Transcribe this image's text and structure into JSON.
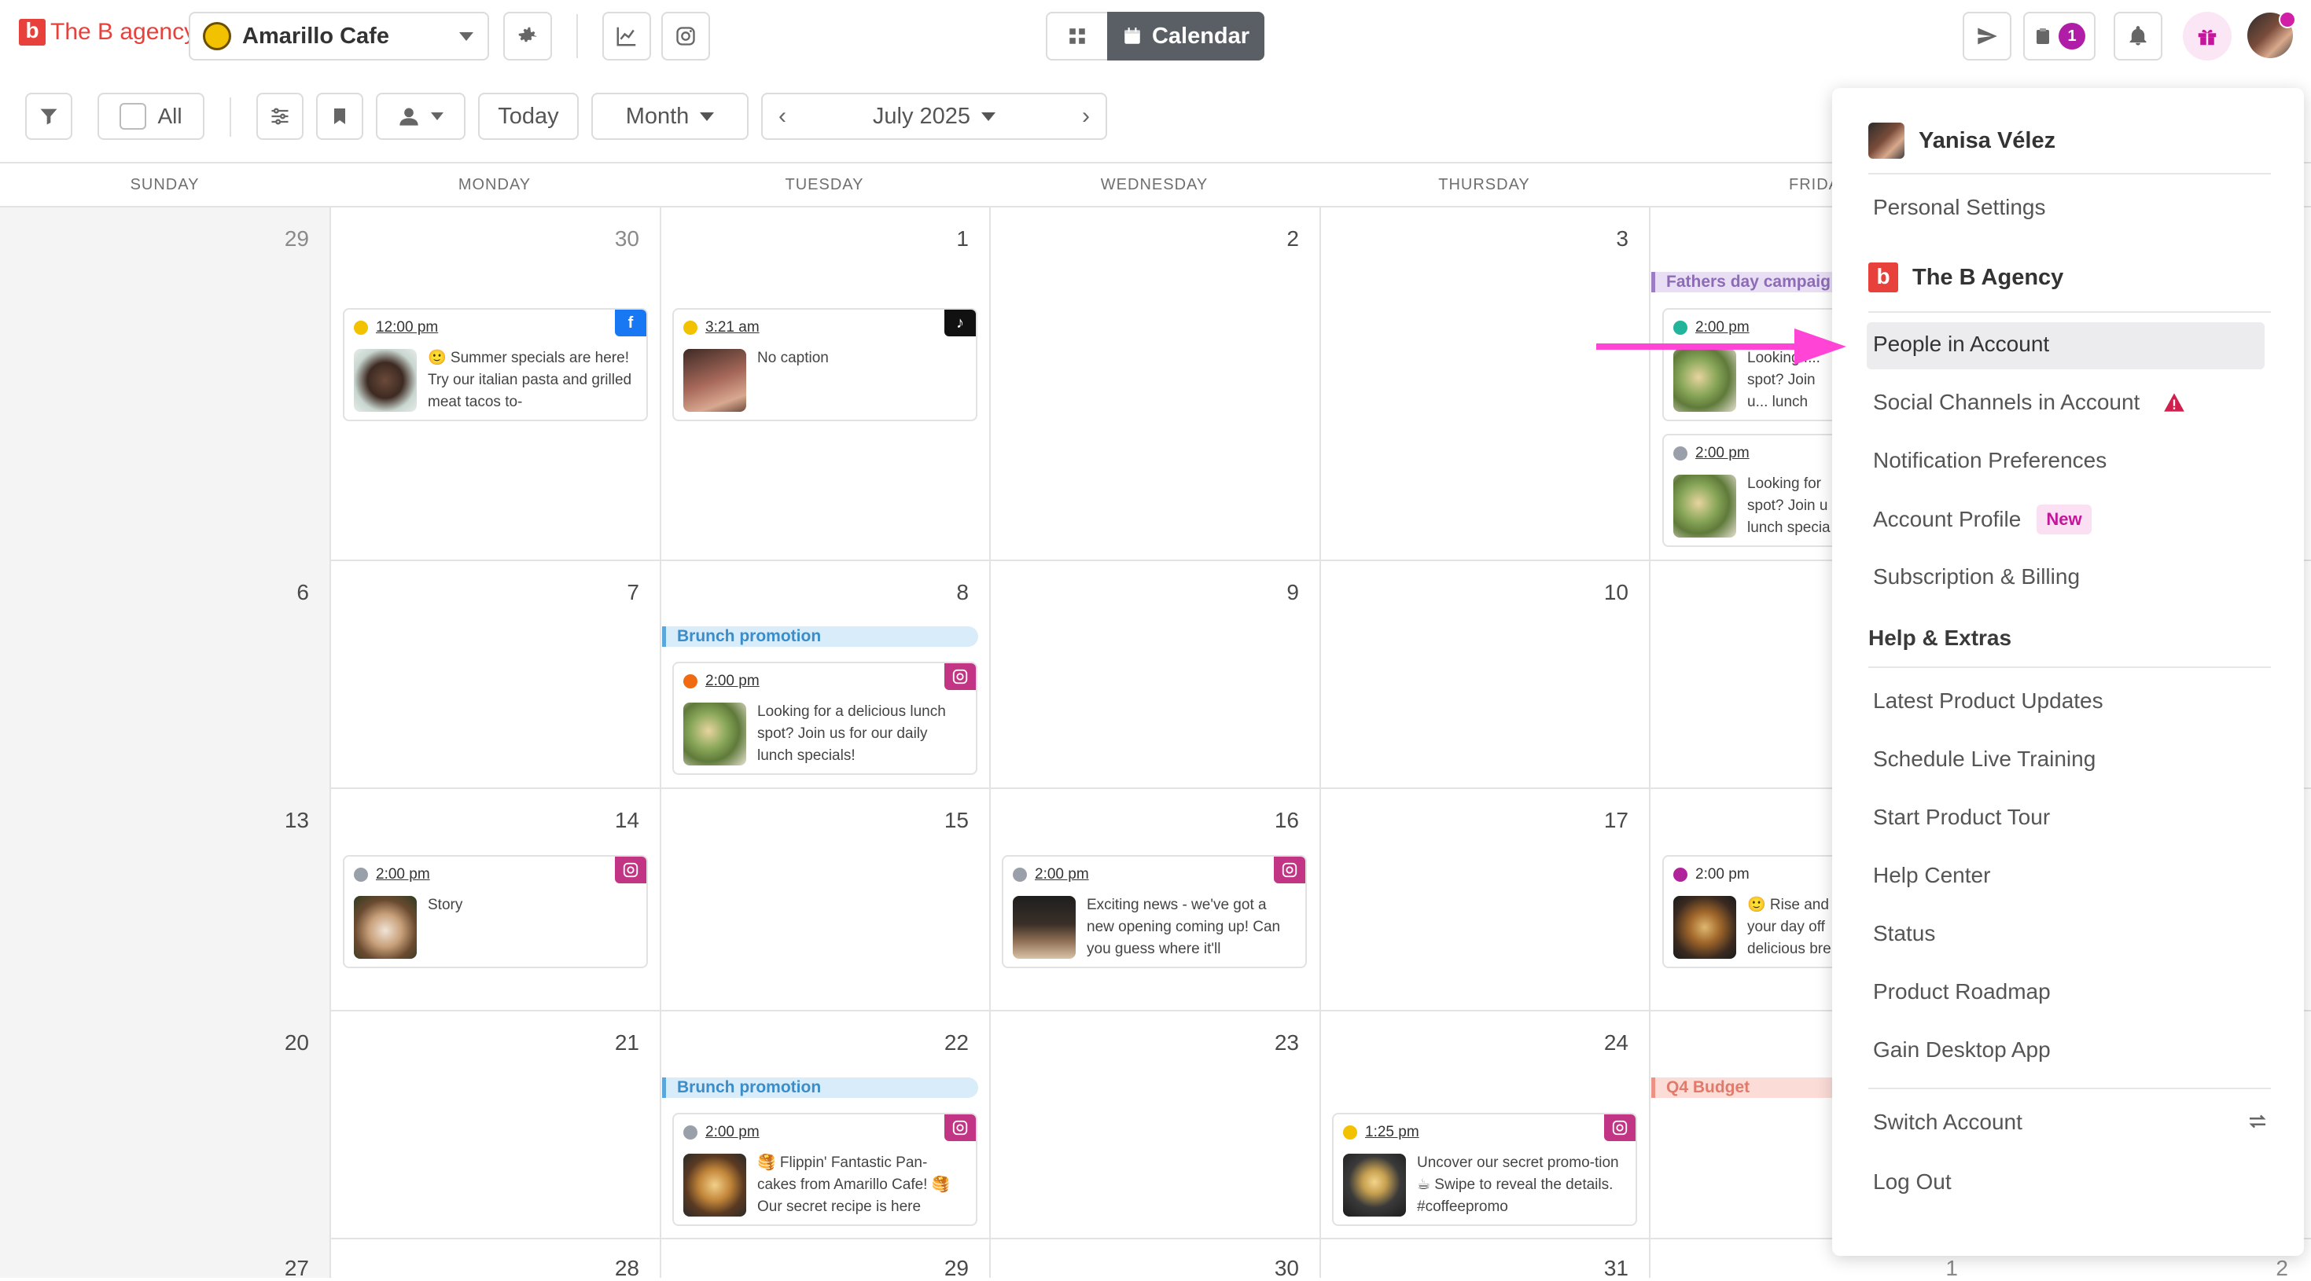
{
  "top": {
    "brand": "The B agency",
    "brand_mark": "b",
    "account": "Amarillo Cafe",
    "calendar_label": "Calendar",
    "badge_count": "1"
  },
  "toolbar": {
    "all_label": "All",
    "today_label": "Today",
    "view_label": "Month",
    "period_label": "July 2025"
  },
  "days": [
    "SUNDAY",
    "MONDAY",
    "TUESDAY",
    "WEDNESDAY",
    "THURSDAY",
    "FRIDA"
  ],
  "dates": {
    "r1": [
      "29",
      "30",
      "1",
      "2",
      "3"
    ],
    "r2": [
      "6",
      "7",
      "8",
      "9",
      "10"
    ],
    "r3": [
      "13",
      "14",
      "15",
      "16",
      "17"
    ],
    "r4": [
      "20",
      "21",
      "22",
      "23",
      "24"
    ],
    "r5": [
      "27",
      "28",
      "29",
      "30",
      "31",
      "1",
      "2"
    ]
  },
  "posts": [
    {
      "time": "12:00 pm",
      "text": "🙂 Summer specials are here! Try our italian pasta and grilled meat tacos to-",
      "platform": "f"
    },
    {
      "time": "3:21 am",
      "text": "No caption",
      "platform": "♪"
    },
    {
      "time": "2:00 pm",
      "text": "Looking f... spot? Join u... lunch specia..."
    },
    {
      "time": "2:00 pm",
      "text": "Looking for spot? Join u lunch specia"
    },
    {
      "time": "2:00 pm",
      "text": "Looking for a delicious lunch spot? Join us for our daily lunch specials!"
    },
    {
      "time": "2:00 pm",
      "text": "Story"
    },
    {
      "time": "2:00 pm",
      "text": "Exciting news - we've got a new opening coming up! Can you guess where it'll"
    },
    {
      "time": "2:00 pm",
      "text": "🙂 Rise and your day off delicious bre"
    },
    {
      "time": "2:00 pm",
      "text": "🥞 Flippin' Fantastic Pan-cakes from Amarillo Cafe! 🥞 Our secret recipe is here"
    },
    {
      "time": "1:25 pm",
      "text": "Uncover our secret promo-tion ☕ Swipe to reveal the details. #coffeepromo"
    }
  ],
  "banners": {
    "fathers": "Fathers day campaig",
    "brunch1": "Brunch promotion",
    "brunch2": "Brunch promotion",
    "q4": "Q4 Budget"
  },
  "menu": {
    "user": "Yanisa Vélez",
    "personal": "Personal Settings",
    "agency": "The B Agency",
    "people": "People in Account",
    "social": "Social Channels in Account",
    "notif": "Notification Preferences",
    "profile": "Account Profile",
    "new_badge": "New",
    "billing": "Subscription & Billing",
    "help_title": "Help & Extras",
    "updates": "Latest Product Updates",
    "training": "Schedule Live Training",
    "tour": "Start Product Tour",
    "help_center": "Help Center",
    "status": "Status",
    "roadmap": "Product Roadmap",
    "desktop": "Gain Desktop App",
    "switch": "Switch Account",
    "logout": "Log Out"
  },
  "colors": {
    "brand_red": "#e8413c",
    "accent_pink": "#d11fa8",
    "arrow": "#ff44d6",
    "facebook": "#1877f2",
    "instagram": "#c13584"
  }
}
